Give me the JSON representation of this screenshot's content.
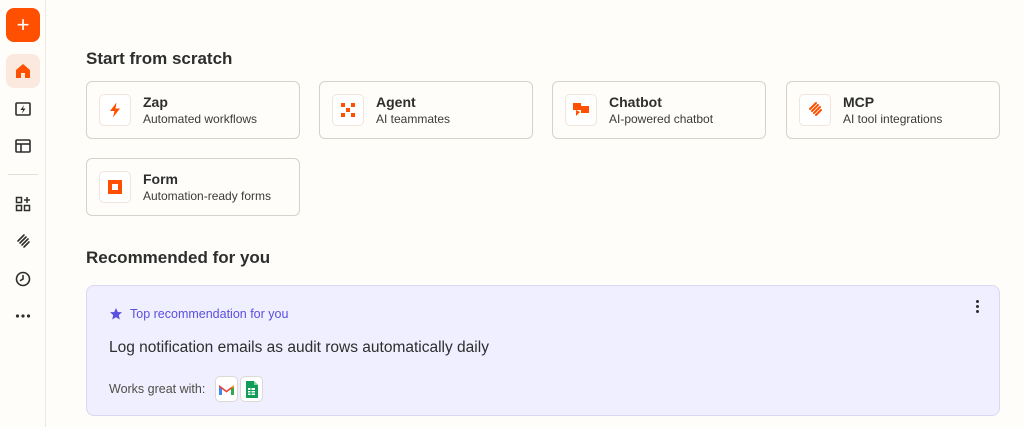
{
  "colors": {
    "brand": "#ff4f00",
    "recommendation_accent": "#5b4fe0",
    "recommendation_bg": "#f0efff"
  },
  "sidebar": {
    "create_label": "+",
    "items": [
      {
        "icon": "home-icon",
        "active": true
      },
      {
        "icon": "zaps-icon",
        "active": false
      },
      {
        "icon": "tables-icon",
        "active": false
      },
      {
        "icon": "apps-icon",
        "active": false
      },
      {
        "icon": "mcp-icon",
        "active": false
      },
      {
        "icon": "history-icon",
        "active": false
      },
      {
        "icon": "more-icon",
        "active": false
      }
    ]
  },
  "scratch": {
    "title": "Start from scratch",
    "cards": [
      {
        "title": "Zap",
        "subtitle": "Automated workflows",
        "icon": "zap-icon"
      },
      {
        "title": "Agent",
        "subtitle": "AI teammates",
        "icon": "agent-icon"
      },
      {
        "title": "Chatbot",
        "subtitle": "AI-powered chatbot",
        "icon": "chatbot-icon"
      },
      {
        "title": "MCP",
        "subtitle": "AI tool integrations",
        "icon": "mcp-icon"
      },
      {
        "title": "Form",
        "subtitle": "Automation-ready forms",
        "icon": "form-icon"
      }
    ]
  },
  "recommended": {
    "title": "Recommended for you",
    "tag": "Top recommendation for you",
    "headline": "Log notification emails as audit rows automatically daily",
    "works_label": "Works great with:",
    "apps": [
      "gmail-icon",
      "google-sheets-icon"
    ]
  }
}
